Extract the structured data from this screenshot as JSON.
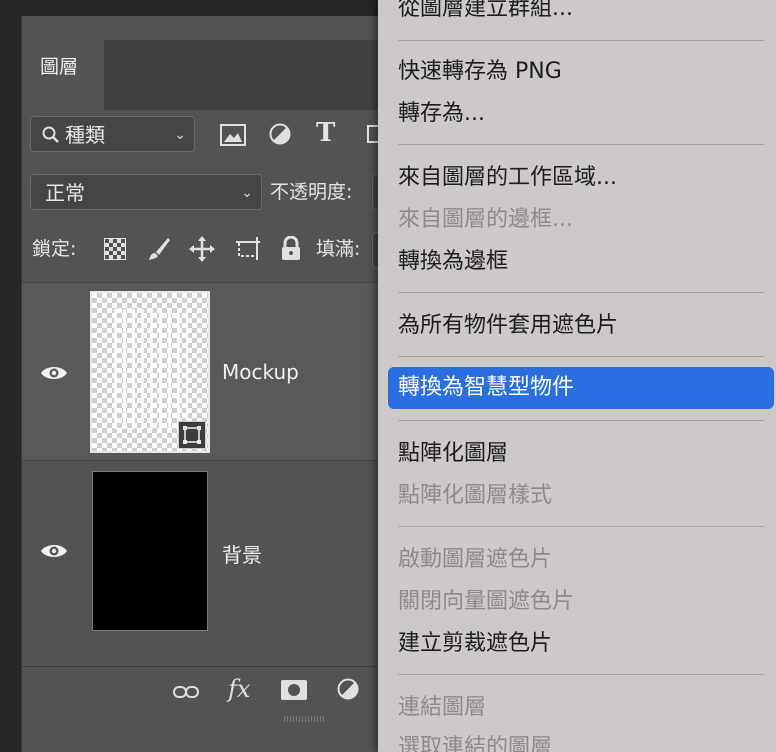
{
  "panel": {
    "tab_label": "圖層",
    "filter_kind": "種類",
    "blend_mode": "正常",
    "opacity_label": "不透明度:",
    "lock_label": "鎖定:",
    "fill_label": "填滿:"
  },
  "layers": [
    {
      "name": "Mockup",
      "visible": true,
      "thumbnail": "checker"
    },
    {
      "name": "背景",
      "visible": true,
      "thumbnail": "black"
    }
  ],
  "footer": {
    "fx_label": "fx"
  },
  "menu": {
    "items": [
      {
        "label": "從圖層建立群組...",
        "enabled": true
      },
      {
        "label": "快速轉存為 PNG",
        "enabled": true
      },
      {
        "label": "轉存為...",
        "enabled": true
      },
      {
        "label": "來自圖層的工作區域...",
        "enabled": true
      },
      {
        "label": "來自圖層的邊框...",
        "enabled": false
      },
      {
        "label": "轉換為邊框",
        "enabled": true
      },
      {
        "label": "為所有物件套用遮色片",
        "enabled": true
      },
      {
        "label": "轉換為智慧型物件",
        "enabled": true,
        "highlighted": true
      },
      {
        "label": "點陣化圖層",
        "enabled": true
      },
      {
        "label": "點陣化圖層樣式",
        "enabled": false
      },
      {
        "label": "啟動圖層遮色片",
        "enabled": false
      },
      {
        "label": "關閉向量圖遮色片",
        "enabled": false
      },
      {
        "label": "建立剪裁遮色片",
        "enabled": true
      },
      {
        "label": "連結圖層",
        "enabled": false
      },
      {
        "label": "選取連結的圖層",
        "enabled": false
      }
    ]
  },
  "colors": {
    "panel_bg": "#535353",
    "menu_bg": "#cdc9c9",
    "highlight": "#2a6ee0"
  }
}
